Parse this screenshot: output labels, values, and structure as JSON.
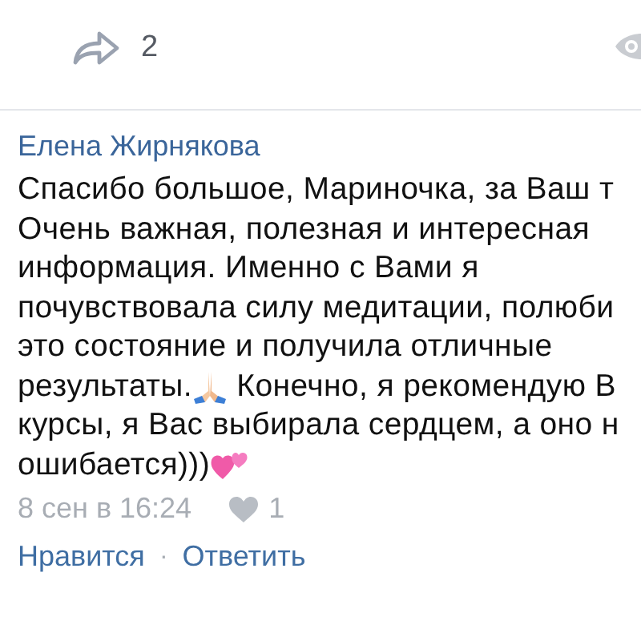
{
  "post_footer": {
    "share_count": "2"
  },
  "comment": {
    "author": "Елена Жирнякова",
    "lines": [
      [
        {
          "kind": "text",
          "text": "Спасибо большое, Мариночка, за Ваш т"
        }
      ],
      [
        {
          "kind": "text",
          "text": "Очень важная, полезная и интересная"
        }
      ],
      [
        {
          "kind": "text",
          "text": "информация. Именно с Вами я"
        }
      ],
      [
        {
          "kind": "text",
          "text": "почувствовала силу медитации, полюби"
        }
      ],
      [
        {
          "kind": "text",
          "text": "это состояние и получила отличные"
        }
      ],
      [
        {
          "kind": "text",
          "text": "результаты."
        },
        {
          "kind": "pray"
        },
        {
          "kind": "text",
          "text": " Конечно, я рекомендую В"
        }
      ],
      [
        {
          "kind": "text",
          "text": "курсы, я Вас выбирала сердцем, а оно н"
        }
      ],
      [
        {
          "kind": "text",
          "text": "ошибается)))"
        },
        {
          "kind": "hearts"
        }
      ]
    ],
    "date": "8 сен в 16:24",
    "like_count": "1",
    "actions": [
      "Нравится",
      "Ответить"
    ],
    "action_separator": "·"
  }
}
